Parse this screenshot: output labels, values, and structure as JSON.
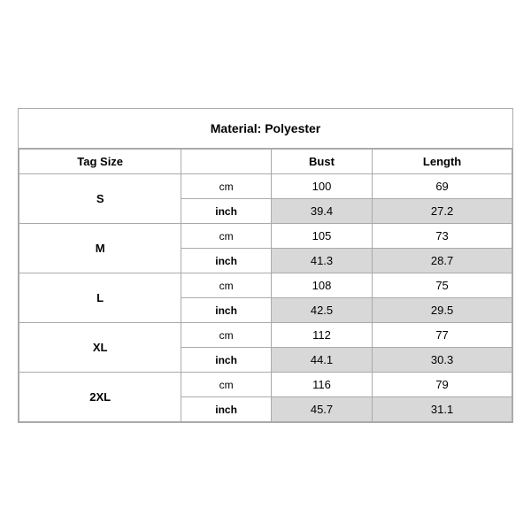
{
  "title": "Material: Polyester",
  "headers": {
    "tag_size": "Tag Size",
    "bust": "Bust",
    "length": "Length"
  },
  "sizes": [
    {
      "tag": "S",
      "cm": {
        "bust": "100",
        "length": "69"
      },
      "inch": {
        "bust": "39.4",
        "length": "27.2"
      }
    },
    {
      "tag": "M",
      "cm": {
        "bust": "105",
        "length": "73"
      },
      "inch": {
        "bust": "41.3",
        "length": "28.7"
      }
    },
    {
      "tag": "L",
      "cm": {
        "bust": "108",
        "length": "75"
      },
      "inch": {
        "bust": "42.5",
        "length": "29.5"
      }
    },
    {
      "tag": "XL",
      "cm": {
        "bust": "112",
        "length": "77"
      },
      "inch": {
        "bust": "44.1",
        "length": "30.3"
      }
    },
    {
      "tag": "2XL",
      "cm": {
        "bust": "116",
        "length": "79"
      },
      "inch": {
        "bust": "45.7",
        "length": "31.1"
      }
    }
  ],
  "unit_labels": {
    "cm": "cm",
    "inch": "inch"
  }
}
